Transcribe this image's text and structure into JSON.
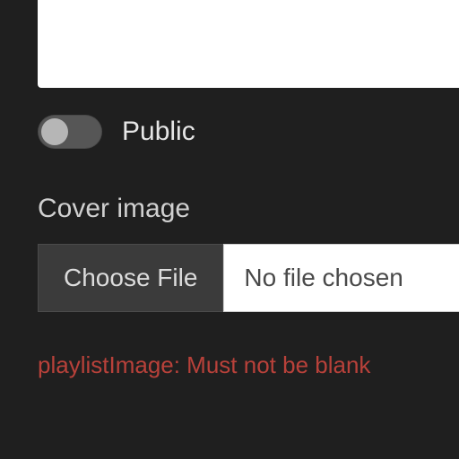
{
  "toggle": {
    "label": "Public",
    "on": false
  },
  "cover": {
    "section_label": "Cover image",
    "choose_label": "Choose File",
    "status": "No file chosen"
  },
  "error": "playlistImage: Must not be blank"
}
